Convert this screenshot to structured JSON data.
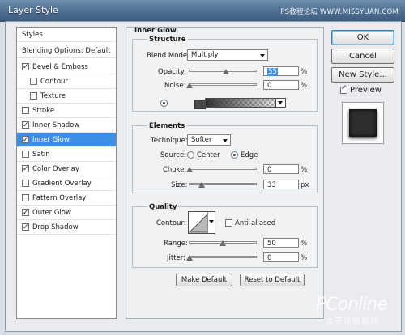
{
  "window": {
    "title": "Layer Style",
    "watermark": "PS教程论坛 WWW.MISSYUAN.COM"
  },
  "styles_list": {
    "header": "Styles",
    "blending_options": "Blending Options: Default",
    "items": [
      {
        "label": "Bevel & Emboss",
        "checked": true,
        "sub": false
      },
      {
        "label": "Contour",
        "checked": false,
        "sub": true
      },
      {
        "label": "Texture",
        "checked": false,
        "sub": true
      },
      {
        "label": "Stroke",
        "checked": false,
        "sub": false
      },
      {
        "label": "Inner Shadow",
        "checked": true,
        "sub": false
      },
      {
        "label": "Inner Glow",
        "checked": true,
        "sub": false,
        "selected": true
      },
      {
        "label": "Satin",
        "checked": false,
        "sub": false
      },
      {
        "label": "Color Overlay",
        "checked": true,
        "sub": false
      },
      {
        "label": "Gradient Overlay",
        "checked": false,
        "sub": false
      },
      {
        "label": "Pattern Overlay",
        "checked": false,
        "sub": false
      },
      {
        "label": "Outer Glow",
        "checked": true,
        "sub": false
      },
      {
        "label": "Drop Shadow",
        "checked": true,
        "sub": false
      }
    ]
  },
  "inner_glow": {
    "title": "Inner Glow",
    "structure": {
      "title": "Structure",
      "blend_mode_label": "Blend Mode:",
      "blend_mode_value": "Multiply",
      "opacity_label": "Opacity:",
      "opacity_value": "55",
      "opacity_unit": "%",
      "noise_label": "Noise:",
      "noise_value": "0",
      "noise_unit": "%",
      "color_mode": "solid",
      "glow_color": "#4a4a4a"
    },
    "elements": {
      "title": "Elements",
      "technique_label": "Technique:",
      "technique_value": "Softer",
      "source_label": "Source:",
      "source_center": "Center",
      "source_edge": "Edge",
      "source_selected": "Edge",
      "choke_label": "Choke:",
      "choke_value": "0",
      "choke_unit": "%",
      "size_label": "Size:",
      "size_value": "33",
      "size_unit": "px"
    },
    "quality": {
      "title": "Quality",
      "contour_label": "Contour:",
      "anti_aliased_label": "Anti-aliased",
      "anti_aliased_checked": false,
      "range_label": "Range:",
      "range_value": "50",
      "range_unit": "%",
      "jitter_label": "Jitter:",
      "jitter_value": "0",
      "jitter_unit": "%"
    },
    "make_default": "Make Default",
    "reset_to_default": "Reset to Default"
  },
  "actions": {
    "ok": "OK",
    "cancel": "Cancel",
    "new_style": "New Style...",
    "preview_label": "Preview",
    "preview_checked": true
  },
  "corner_logo": {
    "brand": "PConline",
    "subtitle": "太平洋电脑网"
  },
  "colors": {
    "selection": "#3d8ee6",
    "title_bar": "#4f6f92"
  }
}
